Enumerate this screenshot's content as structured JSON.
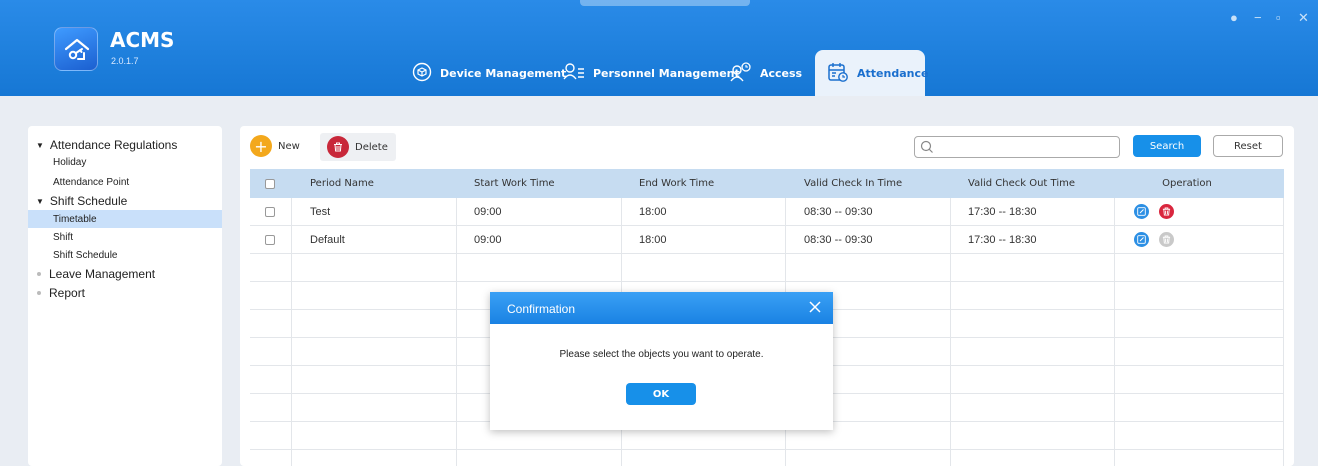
{
  "app": {
    "name": "ACMS",
    "version": "2.0.1.7"
  },
  "nav": [
    {
      "label": "Device Management",
      "icon": "device-icon"
    },
    {
      "label": "Personnel Management",
      "icon": "personnel-icon"
    },
    {
      "label": "Access",
      "icon": "access-icon"
    },
    {
      "label": "Attendance",
      "icon": "attendance-icon",
      "active": true
    }
  ],
  "sidebar": {
    "groups": [
      {
        "label": "Attendance Regulations",
        "items": [
          "Holiday",
          "Attendance Point"
        ]
      },
      {
        "label": "Shift Schedule",
        "items": [
          "Timetable",
          "Shift",
          "Shift Schedule"
        ],
        "selected": "Timetable"
      },
      {
        "label": "Leave Management"
      },
      {
        "label": "Report"
      }
    ]
  },
  "toolbar": {
    "new_label": "New",
    "delete_label": "Delete",
    "search_label": "Search",
    "reset_label": "Reset",
    "search_value": ""
  },
  "table": {
    "headers": [
      "Period Name",
      "Start Work Time",
      "End Work Time",
      "Valid Check In Time",
      "Valid Check Out Time",
      "Operation"
    ],
    "rows": [
      [
        "Test",
        "09:00",
        "18:00",
        "08:30 -- 09:30",
        "17:30 -- 18:30"
      ],
      [
        "Default",
        "09:00",
        "18:00",
        "08:30 -- 09:30",
        "17:30 -- 18:30"
      ]
    ]
  },
  "dialog": {
    "title": "Confirmation",
    "message": "Please select the objects you want to operate.",
    "ok_label": "OK"
  },
  "colors": {
    "header_blue": "#1b7ddb",
    "accent_blue": "#1790e9",
    "new_orange": "#f3a81c",
    "delete_red": "#c8283a",
    "selected_row": "#c9e0fa"
  }
}
